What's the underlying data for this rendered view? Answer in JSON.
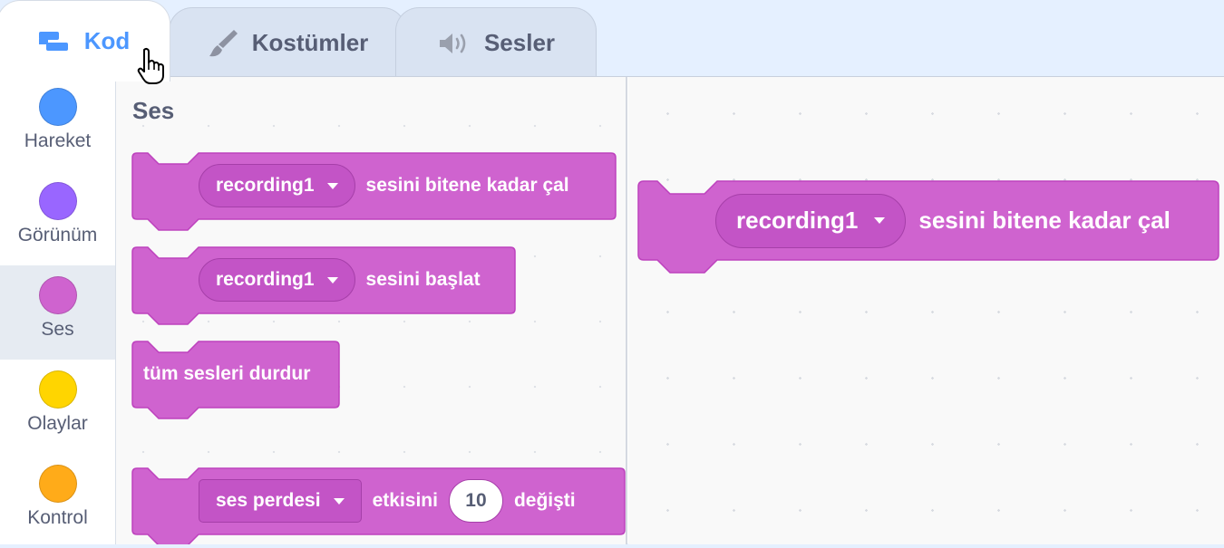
{
  "tabs": [
    {
      "label": "Kod",
      "icon": "code-blocks-icon",
      "active": true
    },
    {
      "label": "Kostümler",
      "icon": "paintbrush-icon",
      "active": false
    },
    {
      "label": "Sesler",
      "icon": "speaker-icon",
      "active": false
    }
  ],
  "categories": [
    {
      "label": "Hareket",
      "color": "#4c97ff"
    },
    {
      "label": "Görünüm",
      "color": "#9966ff"
    },
    {
      "label": "Ses",
      "color": "#cf63cf",
      "selected": true
    },
    {
      "label": "Olaylar",
      "color": "#ffd500"
    },
    {
      "label": "Kontrol",
      "color": "#ffab19"
    }
  ],
  "palette": {
    "section_title": "Ses",
    "blocks": [
      {
        "menu_value": "recording1",
        "text": "sesini bitene kadar çal"
      },
      {
        "menu_value": "recording1",
        "text": "sesini başlat"
      },
      {
        "text": "tüm sesleri durdur"
      },
      {
        "menu_value": "ses perdesi",
        "text": "etkisini",
        "number": "10",
        "text2": "değişti"
      }
    ]
  },
  "workspace": {
    "block": {
      "menu_value": "recording1",
      "text": "sesini bitene kadar çal"
    }
  },
  "colors": {
    "sound_block": "#cf63cf",
    "sound_block_border": "#bd42bd",
    "sound_block_dark": "#c354c6",
    "accent": "#4c97ff"
  }
}
